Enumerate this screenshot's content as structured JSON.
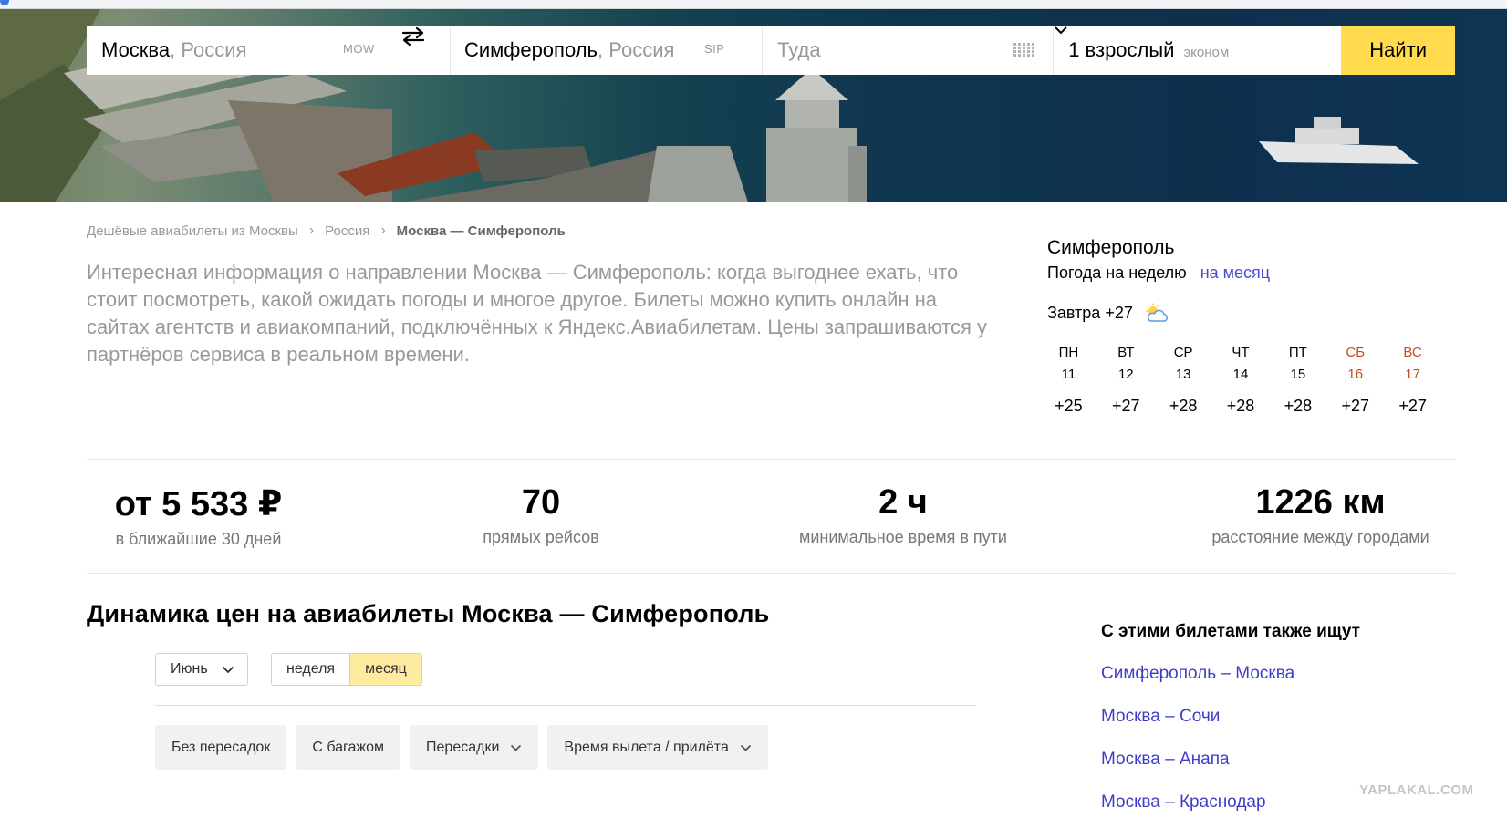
{
  "search": {
    "from_city": "Москва",
    "from_country": "Россия",
    "from_code": "MOW",
    "to_city": "Симферополь",
    "to_country": "Россия",
    "to_code": "SIP",
    "date_placeholder": "Туда",
    "passengers": "1 взрослый",
    "cabin_class": "эконом",
    "find_button": "Найти"
  },
  "breadcrumbs": {
    "item1": "Дешёвые авиабилеты из Москвы",
    "item2": "Россия",
    "current": "Москва — Симферополь"
  },
  "intro": {
    "text": "Интересная информация о направлении Москва — Симферополь: когда выгоднее ехать, что стоит посмотреть, какой ожидать погоды и многое другое. Билеты можно купить онлайн на сайтах агентств и авиакомпаний, подключённых к Яндекс.Авиабилетам. Цены запрашиваются у партнёров сервиса в реальном времени."
  },
  "weather": {
    "city": "Симферополь",
    "week_label": "Погода на неделю",
    "month_link": "на месяц",
    "tomorrow": "Завтра +27",
    "tomorrow_icon": "partly-cloudy-icon",
    "days": [
      {
        "dn": "ПН",
        "date": "11",
        "temp": "+25",
        "weekend": false
      },
      {
        "dn": "ВТ",
        "date": "12",
        "temp": "+27",
        "weekend": false
      },
      {
        "dn": "СР",
        "date": "13",
        "temp": "+28",
        "weekend": false
      },
      {
        "dn": "ЧТ",
        "date": "14",
        "temp": "+28",
        "weekend": false
      },
      {
        "dn": "ПТ",
        "date": "15",
        "temp": "+28",
        "weekend": false
      },
      {
        "dn": "СБ",
        "date": "16",
        "temp": "+27",
        "weekend": true
      },
      {
        "dn": "ВС",
        "date": "17",
        "temp": "+27",
        "weekend": true
      }
    ],
    "weekend_color": "#c94a1a"
  },
  "stats": {
    "price_value": "от 5 533 ₽",
    "price_label": "в ближайшие 30 дней",
    "flights_value": "70",
    "flights_label": "прямых рейсов",
    "time_value": "2 ч",
    "time_label": "минимальное время в пути",
    "distance_value": "1226 км",
    "distance_label": "расстояние между городами"
  },
  "dynamics": {
    "title": "Динамика цен на авиабилеты Москва — Симферополь",
    "month": "Июнь",
    "period_week": "неделя",
    "period_month": "месяц",
    "filters": {
      "nonstop": "Без пересадок",
      "baggage": "С багажом",
      "transfers": "Пересадки",
      "times": "Время вылета / прилёта"
    }
  },
  "related": {
    "title": "С этими билетами также ищут",
    "links": [
      "Симферополь – Москва",
      "Москва – Сочи",
      "Москва – Анапа",
      "Москва – Краснодар"
    ]
  },
  "watermark": "YAPLAKAL.COM",
  "colors": {
    "accent_yellow": "#ffdb4d",
    "link_blue": "#3d3dc8"
  }
}
